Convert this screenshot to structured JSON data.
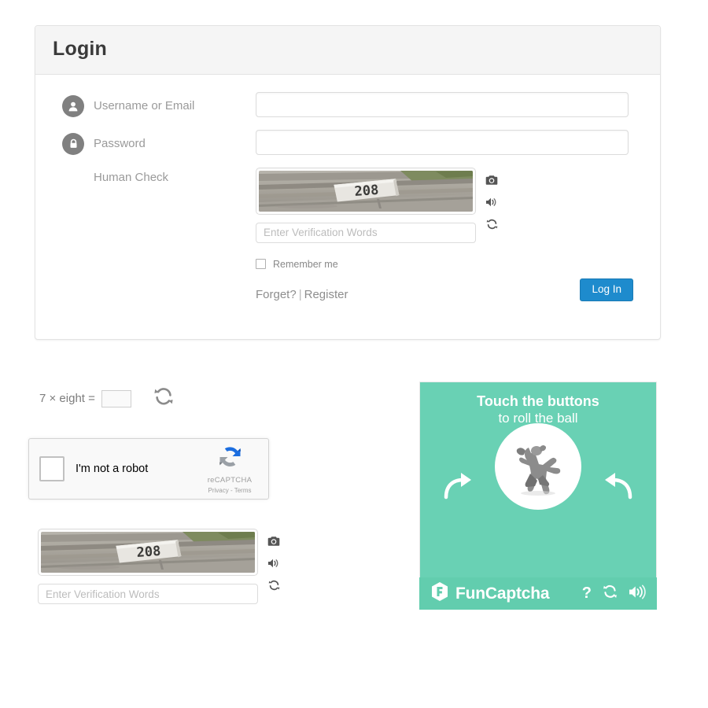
{
  "login": {
    "title": "Login",
    "fields": [
      {
        "icon": "user-icon",
        "label": "Username or Email",
        "value": "",
        "placeholder": ""
      },
      {
        "icon": "lock-icon",
        "label": "Password",
        "value": "",
        "placeholder": ""
      }
    ],
    "human_check_label": "Human Check",
    "captcha": {
      "image_text": "208",
      "image_description": "street view of a curb with house number sign",
      "words_placeholder": "Enter Verification Words",
      "words_value": "",
      "icons": [
        "camera-icon",
        "audio-icon",
        "refresh-icon"
      ]
    },
    "remember_label": "Remember me",
    "remember_checked": false,
    "forgot_label": "Forget?",
    "separator": "|",
    "register_label": "Register",
    "submit_label": "Log In",
    "submit_color": "#1e8bcd",
    "header_bg": "#f5f5f5"
  },
  "math_captcha": {
    "question": "7 × eight =",
    "value": "",
    "refresh_icon": "refresh-icon"
  },
  "recaptcha": {
    "label": "I'm not a robot",
    "brand": "reCAPTCHA",
    "terms": "Privacy - Terms",
    "checked": false,
    "logo_blue": "#1c6ee0",
    "logo_gray": "#9aa0a6"
  },
  "bottom_captcha": {
    "image_text": "208",
    "image_description": "street view of a curb with house number sign",
    "words_placeholder": "Enter Verification Words",
    "words_value": "",
    "icons": [
      "camera-icon",
      "audio-icon",
      "refresh-icon"
    ]
  },
  "funcaptcha": {
    "title": "Touch the buttons",
    "subtitle": "to roll the ball",
    "brand": "FunCaptcha",
    "bg_color": "#69d1b4",
    "footer_color": "#62cdae",
    "figure_description": "grayscale 3d animal figure",
    "help_label": "?",
    "footer_icons": [
      "help-icon",
      "refresh-icon",
      "audio-icon"
    ],
    "arrows": [
      "arrow-right-icon",
      "arrow-left-icon"
    ]
  }
}
